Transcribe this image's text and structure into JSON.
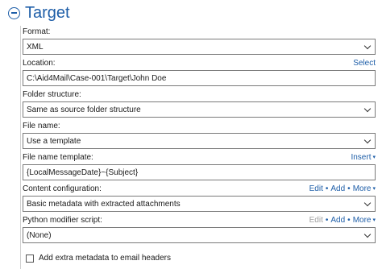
{
  "section": {
    "title": "Target"
  },
  "format": {
    "label": "Format:",
    "value": "XML"
  },
  "location": {
    "label": "Location:",
    "value": "C:\\Aid4Mail\\Case-001\\Target\\John Doe",
    "select": "Select"
  },
  "folder_structure": {
    "label": "Folder structure:",
    "value": "Same as source folder structure"
  },
  "file_name": {
    "label": "File name:",
    "value": "Use a template"
  },
  "file_name_template": {
    "label": "File name template:",
    "value": "{LocalMessageDate}~{Subject}",
    "insert": "Insert",
    "caret": "▾"
  },
  "content_configuration": {
    "label": "Content configuration:",
    "value": "Basic metadata with extracted attachments",
    "edit": "Edit",
    "add": "Add",
    "more": "More",
    "sep": "•",
    "caret": "▾"
  },
  "python_script": {
    "label": "Python modifier script:",
    "value": "(None)",
    "edit": "Edit",
    "add": "Add",
    "more": "More",
    "sep": "•",
    "caret": "▾"
  },
  "extra_metadata": {
    "label": "Add extra metadata to email headers",
    "checked": false
  },
  "colors": {
    "accent": "#1e5ea8",
    "disabled": "#a0a0a0",
    "border": "#7a7a7a"
  }
}
